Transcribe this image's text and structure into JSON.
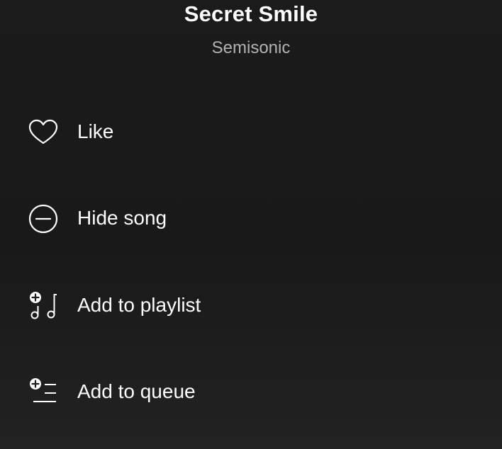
{
  "track": {
    "title": "Secret Smile",
    "artist": "Semisonic"
  },
  "menu": {
    "items": [
      {
        "label": "Like",
        "icon": "heart-icon"
      },
      {
        "label": "Hide song",
        "icon": "minus-circle-icon"
      },
      {
        "label": "Add to playlist",
        "icon": "add-to-playlist-icon"
      },
      {
        "label": "Add to queue",
        "icon": "add-to-queue-icon"
      }
    ]
  },
  "colors": {
    "background": "#1b1b1b",
    "text_primary": "#ffffff",
    "text_secondary": "#b3b3b3"
  }
}
